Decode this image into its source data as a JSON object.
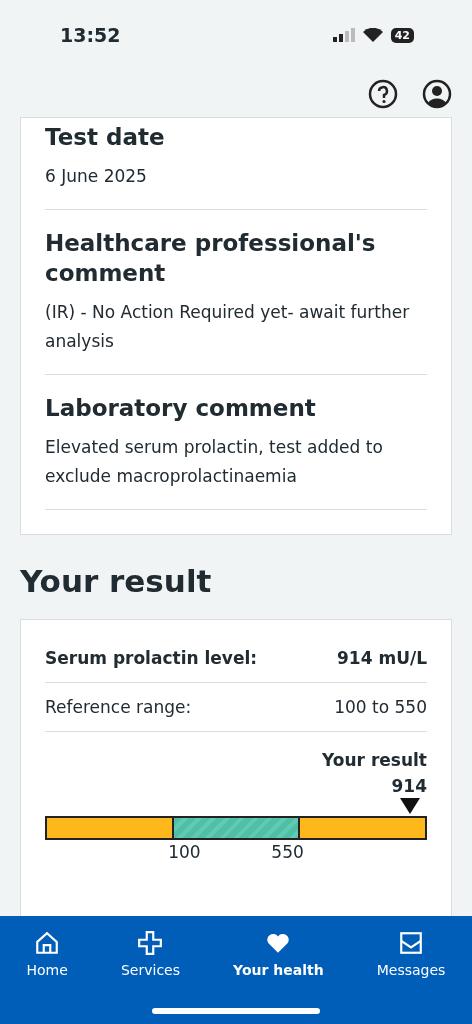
{
  "status_bar": {
    "time": "13:52",
    "battery": "42"
  },
  "details": [
    {
      "heading": "Test date",
      "text": "6 June 2025"
    },
    {
      "heading": "Healthcare professional's comment",
      "text": "(IR) - No Action Required yet- await further analysis"
    },
    {
      "heading": "Laboratory comment",
      "text": "Elevated serum prolactin, test added to exclude macroprolactinaemia"
    }
  ],
  "result_section": {
    "title": "Your result",
    "rows": [
      {
        "label": "Serum prolactin level:",
        "value": "914 mU/L",
        "emphasis": true
      },
      {
        "label": "Reference range:",
        "value": "100 to 550",
        "emphasis": false
      }
    ],
    "marker": {
      "caption": "Your result",
      "value": "914",
      "level": 0.955
    },
    "range_labels": [
      "100",
      "550"
    ]
  },
  "nav": [
    {
      "label": "Home",
      "kind": "home",
      "selected": false
    },
    {
      "label": "Services",
      "kind": "services",
      "selected": false
    },
    {
      "label": "Your health",
      "kind": "health",
      "selected": true
    },
    {
      "label": "Messages",
      "kind": "messages",
      "selected": false
    }
  ]
}
